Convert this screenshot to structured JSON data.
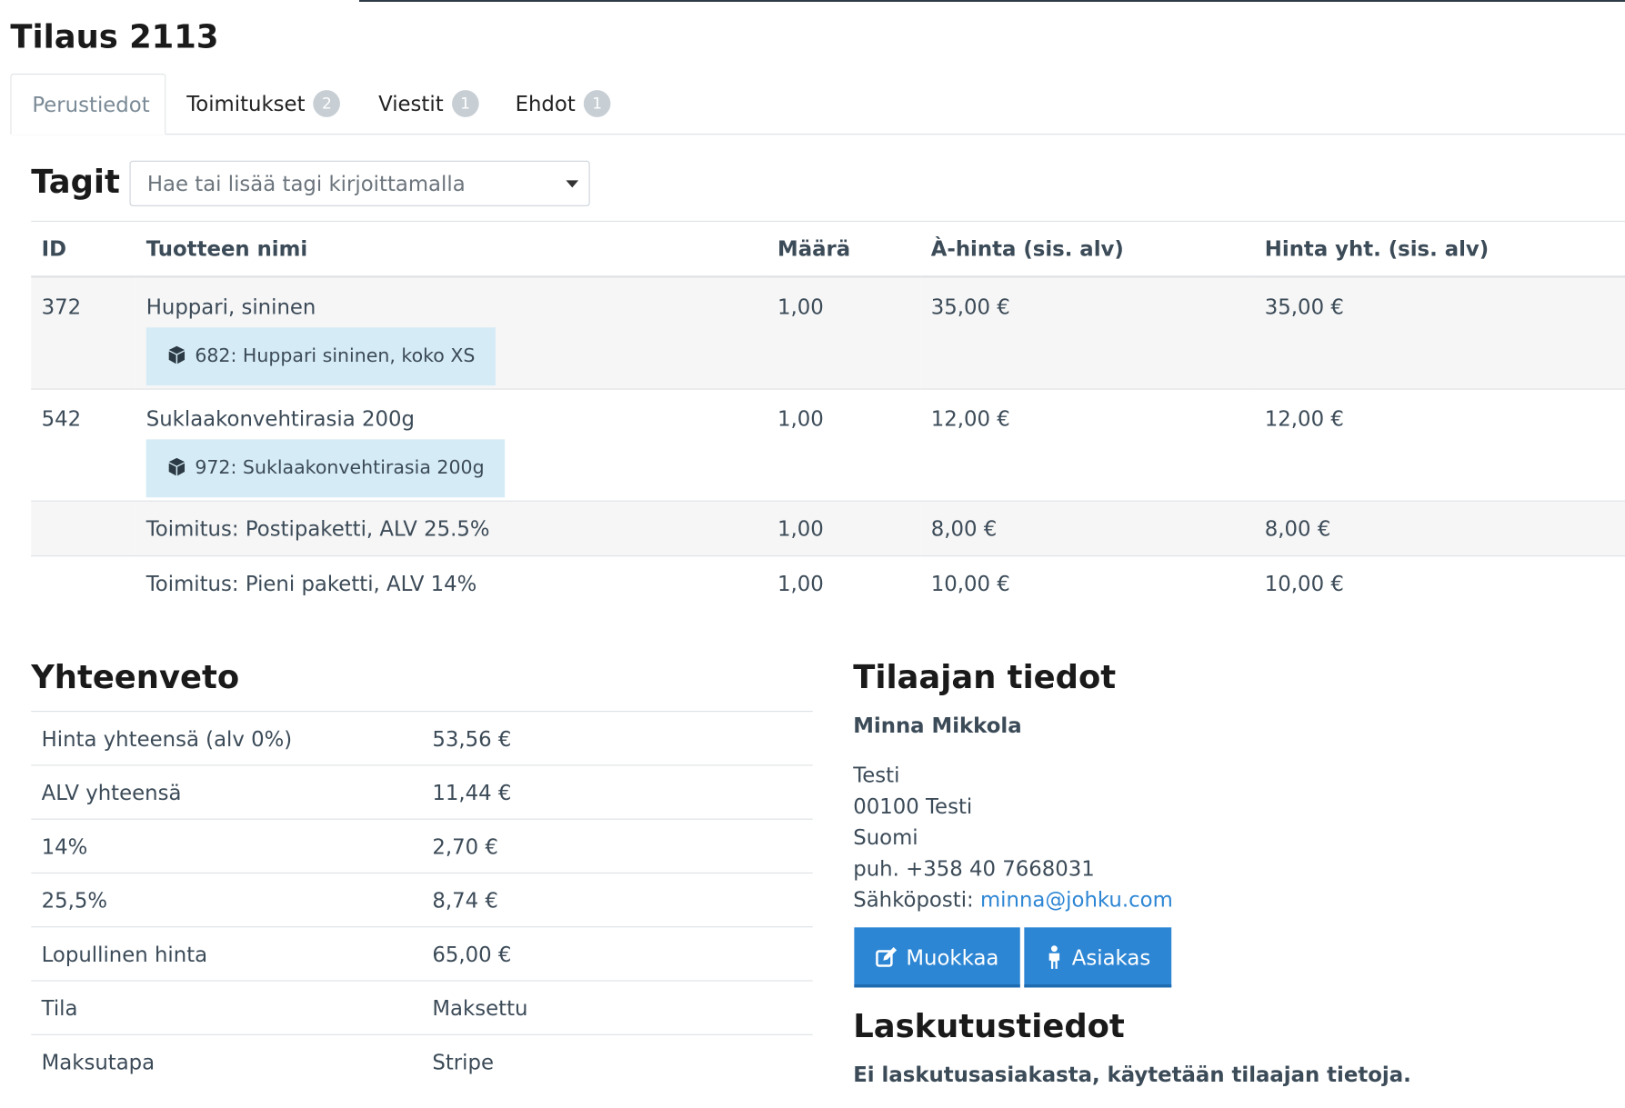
{
  "page": {
    "title": "Tilaus 2113"
  },
  "tabs": [
    {
      "label": "Perustiedot",
      "badge": ""
    },
    {
      "label": "Toimitukset",
      "badge": "2"
    },
    {
      "label": "Viestit",
      "badge": "1"
    },
    {
      "label": "Ehdot",
      "badge": "1"
    }
  ],
  "tags": {
    "label": "Tagit",
    "placeholder": "Hae tai lisää tagi kirjoittamalla"
  },
  "items": {
    "headers": [
      "ID",
      "Tuotteen nimi",
      "Määrä",
      "À-hinta (sis. alv)",
      "Hinta yht. (sis. alv)"
    ],
    "rows": [
      {
        "id": "372",
        "name": "Huppari, sininen",
        "variant": "682: Huppari sininen, koko XS",
        "qty": "1,00",
        "unit": "35,00 €",
        "total": "35,00 €"
      },
      {
        "id": "542",
        "name": "Suklaakonvehtirasia 200g",
        "variant": "972: Suklaakonvehtirasia 200g",
        "qty": "1,00",
        "unit": "12,00 €",
        "total": "12,00 €"
      },
      {
        "id": "",
        "name": "Toimitus: Postipaketti, ALV 25.5%",
        "variant": "",
        "qty": "1,00",
        "unit": "8,00 €",
        "total": "8,00 €"
      },
      {
        "id": "",
        "name": "Toimitus: Pieni paketti, ALV 14%",
        "variant": "",
        "qty": "1,00",
        "unit": "10,00 €",
        "total": "10,00 €"
      }
    ]
  },
  "summary": {
    "title": "Yhteenveto",
    "rows": [
      {
        "k": "Hinta yhteensä (alv 0%)",
        "v": "53,56 €"
      },
      {
        "k": "ALV yhteensä",
        "v": "11,44 €"
      },
      {
        "k": "14%",
        "v": "2,70 €"
      },
      {
        "k": "25,5%",
        "v": "8,74 €"
      },
      {
        "k": "Lopullinen hinta",
        "v": "65,00 €"
      },
      {
        "k": "Tila",
        "v": "Maksettu"
      },
      {
        "k": "Maksutapa",
        "v": "Stripe"
      }
    ]
  },
  "customer": {
    "title": "Tilaajan tiedot",
    "name": "Minna Mikkola",
    "street": "Testi",
    "postal": "00100 Testi",
    "country": "Suomi",
    "phone": "puh. +358 40 7668031",
    "email_label": "Sähköposti: ",
    "email": "minna@johku.com",
    "edit_label": "Muokkaa",
    "customer_label": "Asiakas"
  },
  "billing": {
    "title": "Laskutustiedot",
    "note": "Ei laskutusasiakasta, käytetään tilaajan tietoja."
  },
  "colors": {
    "primary": "#2d86d4",
    "variant_bg": "#d5ebf5",
    "badge": "#c7ced4"
  }
}
